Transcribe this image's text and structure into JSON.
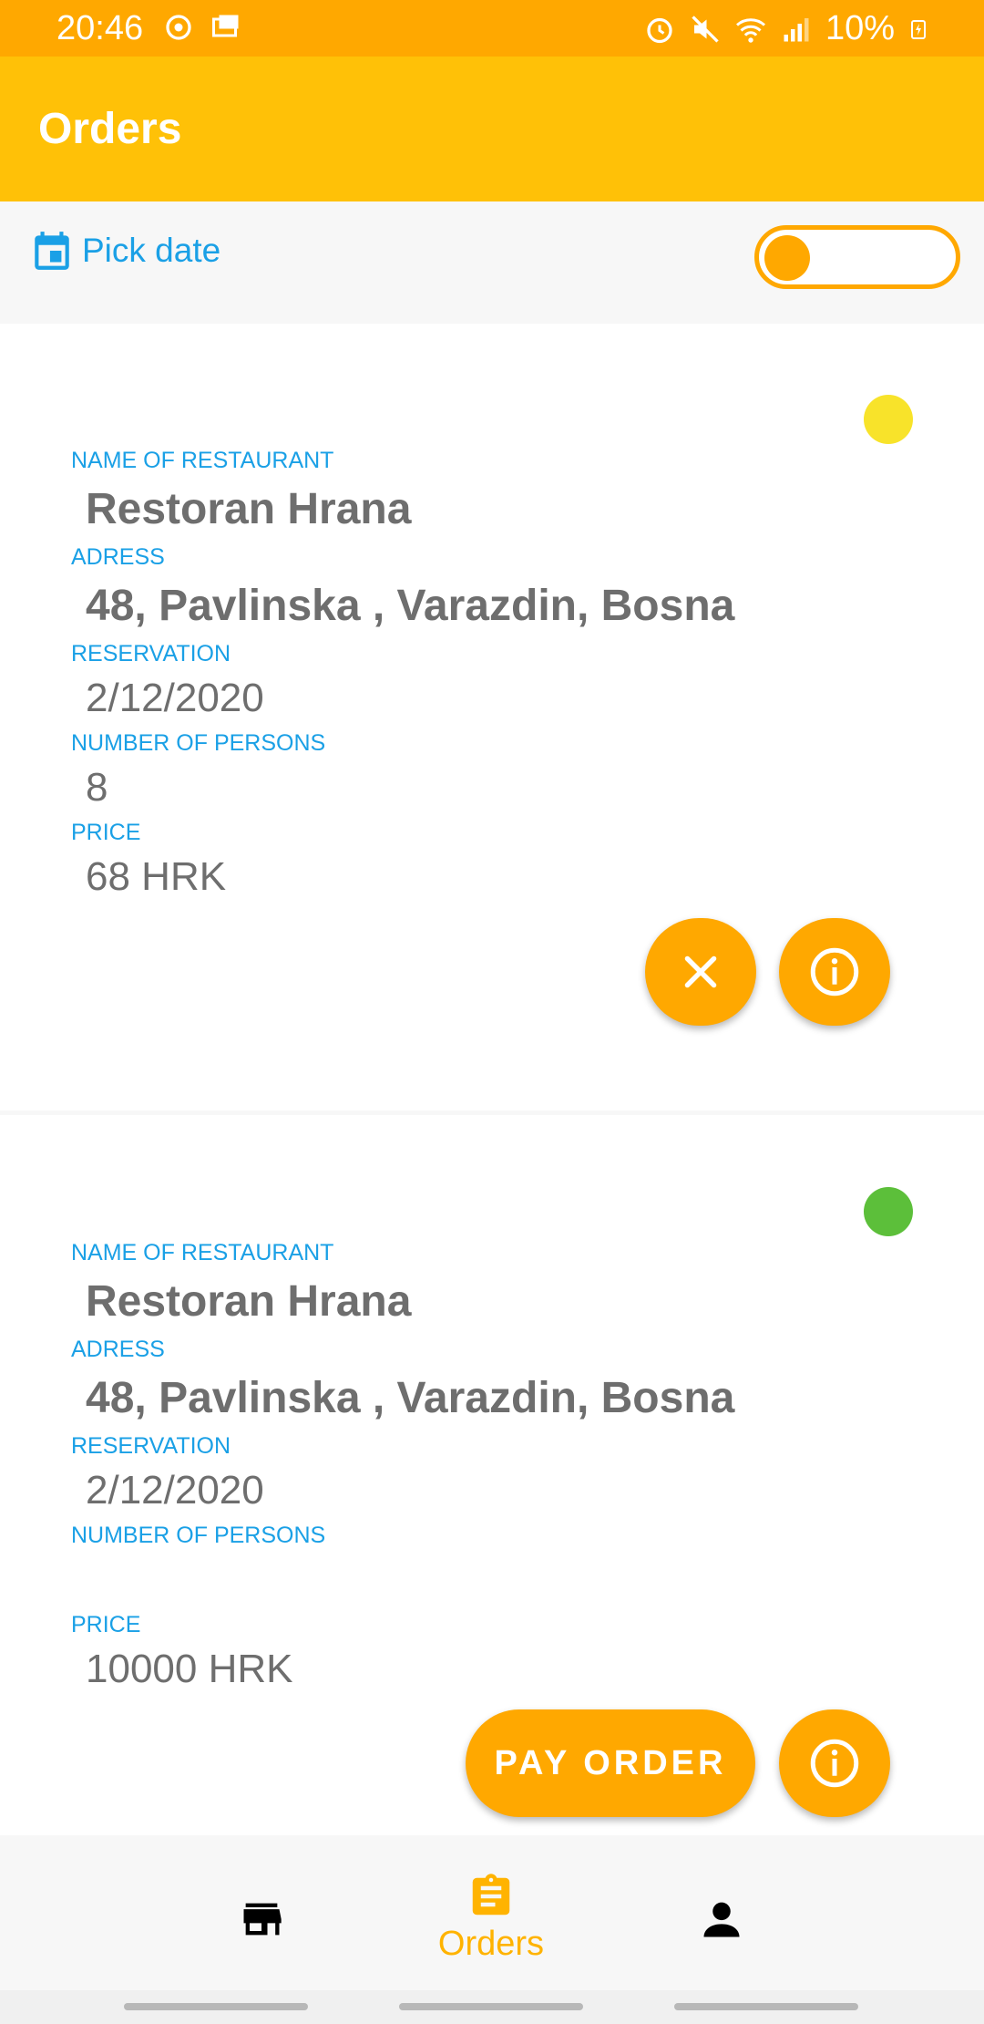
{
  "status_bar": {
    "time": "20:46",
    "battery": "10%",
    "icons": [
      "sync-icon",
      "notification-icon",
      "alarm-icon",
      "mute-icon",
      "wifi-icon",
      "signal-icon",
      "battery-charging-icon"
    ]
  },
  "app_bar": {
    "title": "Orders"
  },
  "toolbar": {
    "pick_date_label": "Pick date",
    "toggle_on": false
  },
  "labels": {
    "name": "NAME OF RESTAURANT",
    "address": "ADRESS",
    "reservation": "RESERVATION",
    "persons": "NUMBER OF PERSONS",
    "price": "PRICE"
  },
  "orders": [
    {
      "restaurant": "Restoran Hrana",
      "address": "48, Pavlinska , Varazdin, Bosna",
      "reservation": "2/12/2020",
      "persons": "8",
      "price": "68 HRK",
      "status_color": "#f8e32a",
      "primary_action": "cancel"
    },
    {
      "restaurant": "Restoran Hrana",
      "address": "48, Pavlinska , Varazdin, Bosna",
      "reservation": "2/12/2020",
      "persons": "",
      "price": "10000 HRK",
      "status_color": "#5cbf3a",
      "primary_action": "PAY ORDER"
    }
  ],
  "bottom_nav": {
    "items": [
      {
        "icon": "store-icon",
        "label": ""
      },
      {
        "icon": "clipboard-icon",
        "label": "Orders",
        "active": true
      },
      {
        "icon": "person-icon",
        "label": ""
      }
    ]
  },
  "colors": {
    "accent": "#ffa800",
    "app_bar": "#ffc107",
    "label": "#1aa0e6",
    "text": "#6e6e6e"
  }
}
